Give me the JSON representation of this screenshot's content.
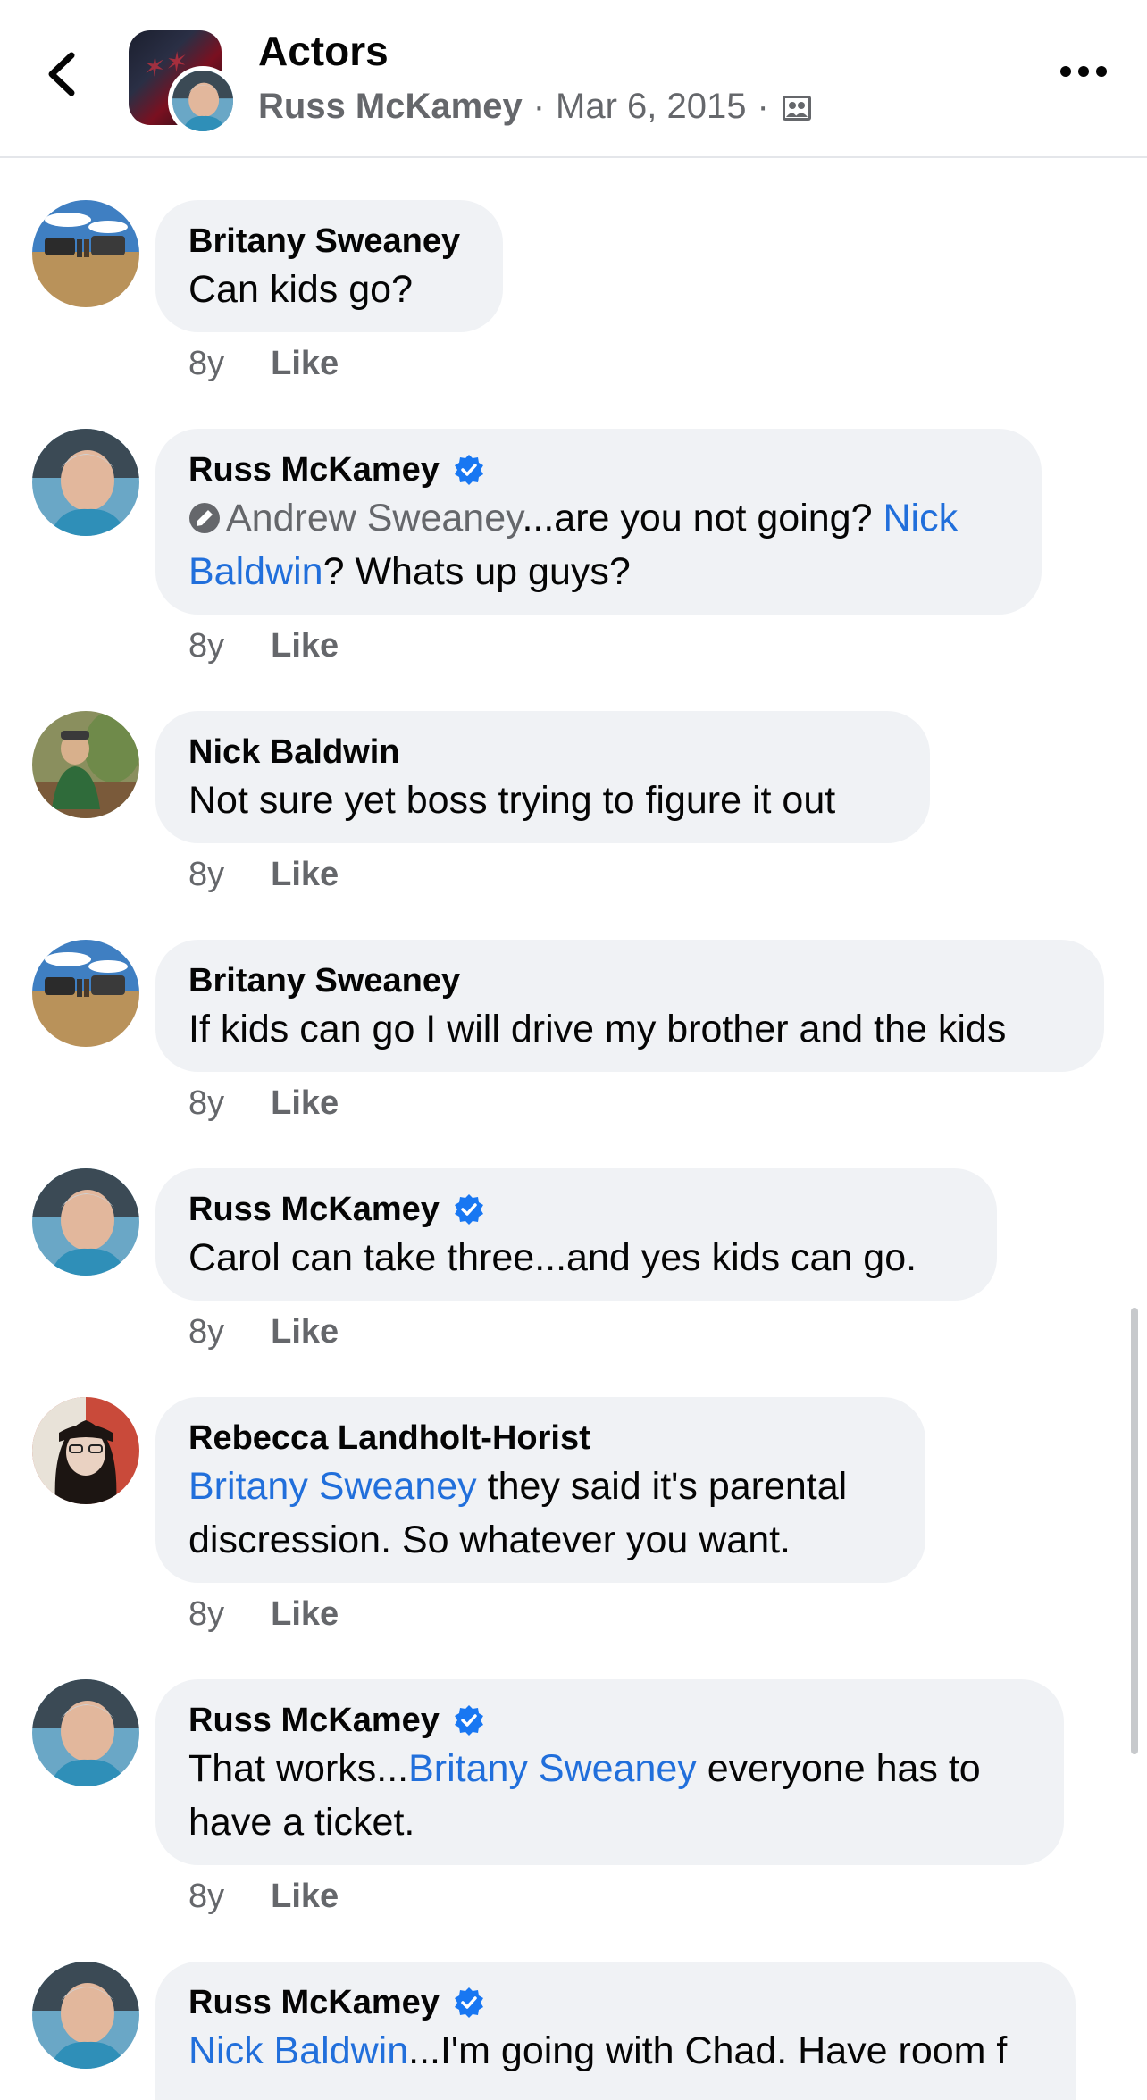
{
  "header": {
    "group_name": "Actors",
    "author": "Russ McKamey",
    "separator": "·",
    "date": "Mar 6, 2015"
  },
  "comments": [
    {
      "name": "Britany Sweaney",
      "verified": false,
      "text": "Can kids go?",
      "age": "8y",
      "like": "Like"
    },
    {
      "name": "Russ McKamey",
      "verified": true,
      "inactive_mention": "Andrew Sweaney",
      "text_a": "...are you not going? ",
      "mention_a": "Nick Baldwin",
      "text_b": "? Whats up guys?",
      "age": "8y",
      "like": "Like"
    },
    {
      "name": "Nick Baldwin",
      "verified": false,
      "text": "Not sure yet boss trying to figure it out",
      "age": "8y",
      "like": "Like"
    },
    {
      "name": "Britany Sweaney",
      "verified": false,
      "text": "If kids can go I will drive my brother and the kids",
      "age": "8y",
      "like": "Like"
    },
    {
      "name": "Russ McKamey",
      "verified": true,
      "text": "Carol can take three...and yes kids can go.",
      "age": "8y",
      "like": "Like"
    },
    {
      "name": "Rebecca Landholt-Horist",
      "verified": false,
      "mention_a": "Britany Sweaney",
      "text_a": " they said it's parental discression. So whatever you want.",
      "age": "8y",
      "like": "Like"
    },
    {
      "name": "Russ McKamey",
      "verified": true,
      "text_pre": "That works...",
      "mention_a": "Britany Sweaney",
      "text_a": " everyone has to have a ticket.",
      "age": "8y",
      "like": "Like"
    },
    {
      "name": "Russ McKamey",
      "verified": true,
      "mention_a": "Nick Baldwin",
      "text_a": "...I'm going with Chad. Have room f"
    }
  ],
  "colors": {
    "bubble": "#f0f2f5",
    "link": "#216fdb",
    "secondary_text": "#65676b",
    "verified": "#1877f2"
  },
  "icons": [
    "back-arrow-icon",
    "group-privacy-icon",
    "more-options-icon",
    "verified-badge-icon"
  ]
}
